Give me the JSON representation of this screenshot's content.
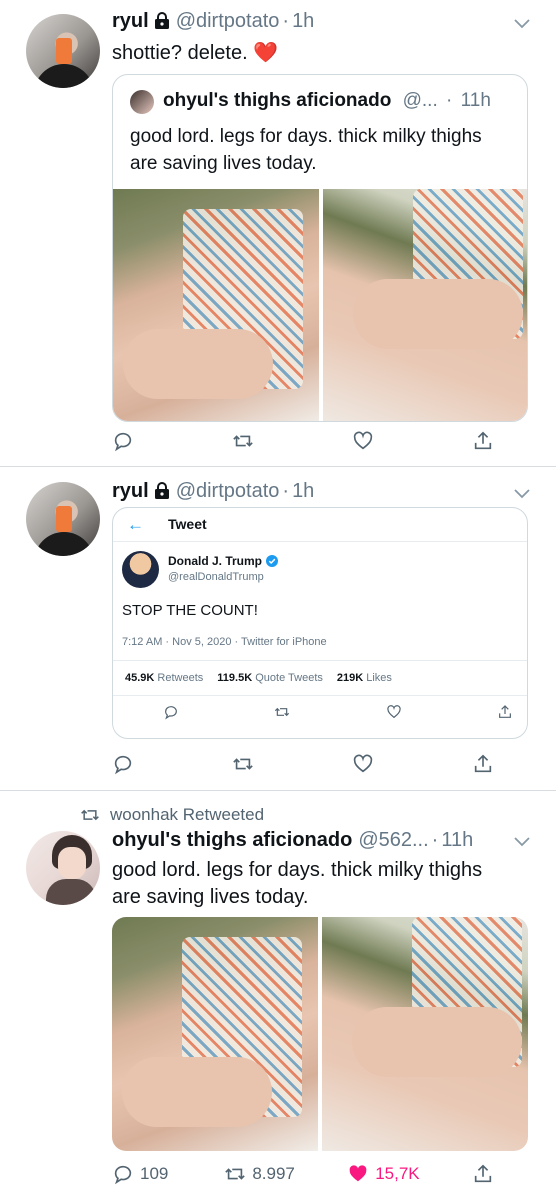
{
  "tweets": [
    {
      "name": "ryul",
      "handle": "@dirtpotato",
      "sep": "·",
      "time": "1h",
      "text": "shottie? delete.",
      "emoji": "❤️",
      "quote": {
        "name": "ohyul's thighs aficionado",
        "handle": "@...",
        "sep": "·",
        "time": "11h",
        "text": "good lord. legs for days. thick milky thighs are saving lives today."
      }
    },
    {
      "name": "ryul",
      "handle": "@dirtpotato",
      "sep": "·",
      "time": "1h",
      "embed": {
        "back": "←",
        "title": "Tweet",
        "author_name": "Donald J. Trump",
        "author_handle": "@realDonaldTrump",
        "text": "STOP THE COUNT!",
        "meta": "7:12 AM · Nov 5, 2020 · Twitter for iPhone",
        "stats": [
          {
            "value": "45.9K",
            "label": "Retweets"
          },
          {
            "value": "119.5K",
            "label": "Quote Tweets"
          },
          {
            "value": "219K",
            "label": "Likes"
          }
        ]
      }
    },
    {
      "retweeted_by": "woonhak Retweeted",
      "name": "ohyul's thighs aficionado",
      "handle": "@562...",
      "sep": "·",
      "time": "11h",
      "text_line1": "good lord. legs for days. thick milky thighs",
      "text_line2": "are saving lives today.",
      "counts": {
        "replies": "109",
        "retweets": "8.997",
        "likes": "15,7K"
      }
    }
  ],
  "colors": {
    "like_active": "#f91880",
    "link_blue": "#1d9bf0",
    "muted": "#536471"
  }
}
